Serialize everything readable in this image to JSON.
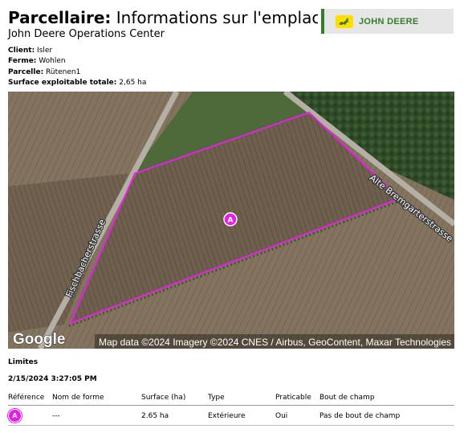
{
  "header": {
    "title_bold": "Parcellaire:",
    "title_rest": " Informations sur l'emplaceme",
    "subtitle": "John Deere Operations Center",
    "logo_text": "JOHN DEERE"
  },
  "meta": {
    "client_label": "Client:",
    "client_value": " Isler",
    "farm_label": "Ferme:",
    "farm_value": " Wohlen",
    "field_label": "Parcelle:",
    "field_value": " Rütenen1",
    "area_label": "Surface exploitable totale:",
    "area_value": " 2,65 ha"
  },
  "map": {
    "road_left": "Fischbacherstrasse",
    "road_right": "Alte Bremgarterstrasse",
    "marker": "A",
    "google": "Google",
    "attribution": "Map data ©2024 Imagery ©2024 CNES / Airbus, GeoContent, Maxar Technologies",
    "boundary_color": "#e61ee6"
  },
  "section": {
    "title": "Limites",
    "timestamp": "2/15/2024 3:27:05 PM"
  },
  "table": {
    "headers": [
      "Référence",
      "Nom de forme",
      "Surface (ha)",
      "Type",
      "Praticable",
      "Bout de champ"
    ],
    "rows": [
      {
        "ref": "A",
        "name": "---",
        "area": "2.65 ha",
        "type": "Extérieure",
        "usable": "Oui",
        "headland": "Pas de bout de champ"
      }
    ]
  }
}
